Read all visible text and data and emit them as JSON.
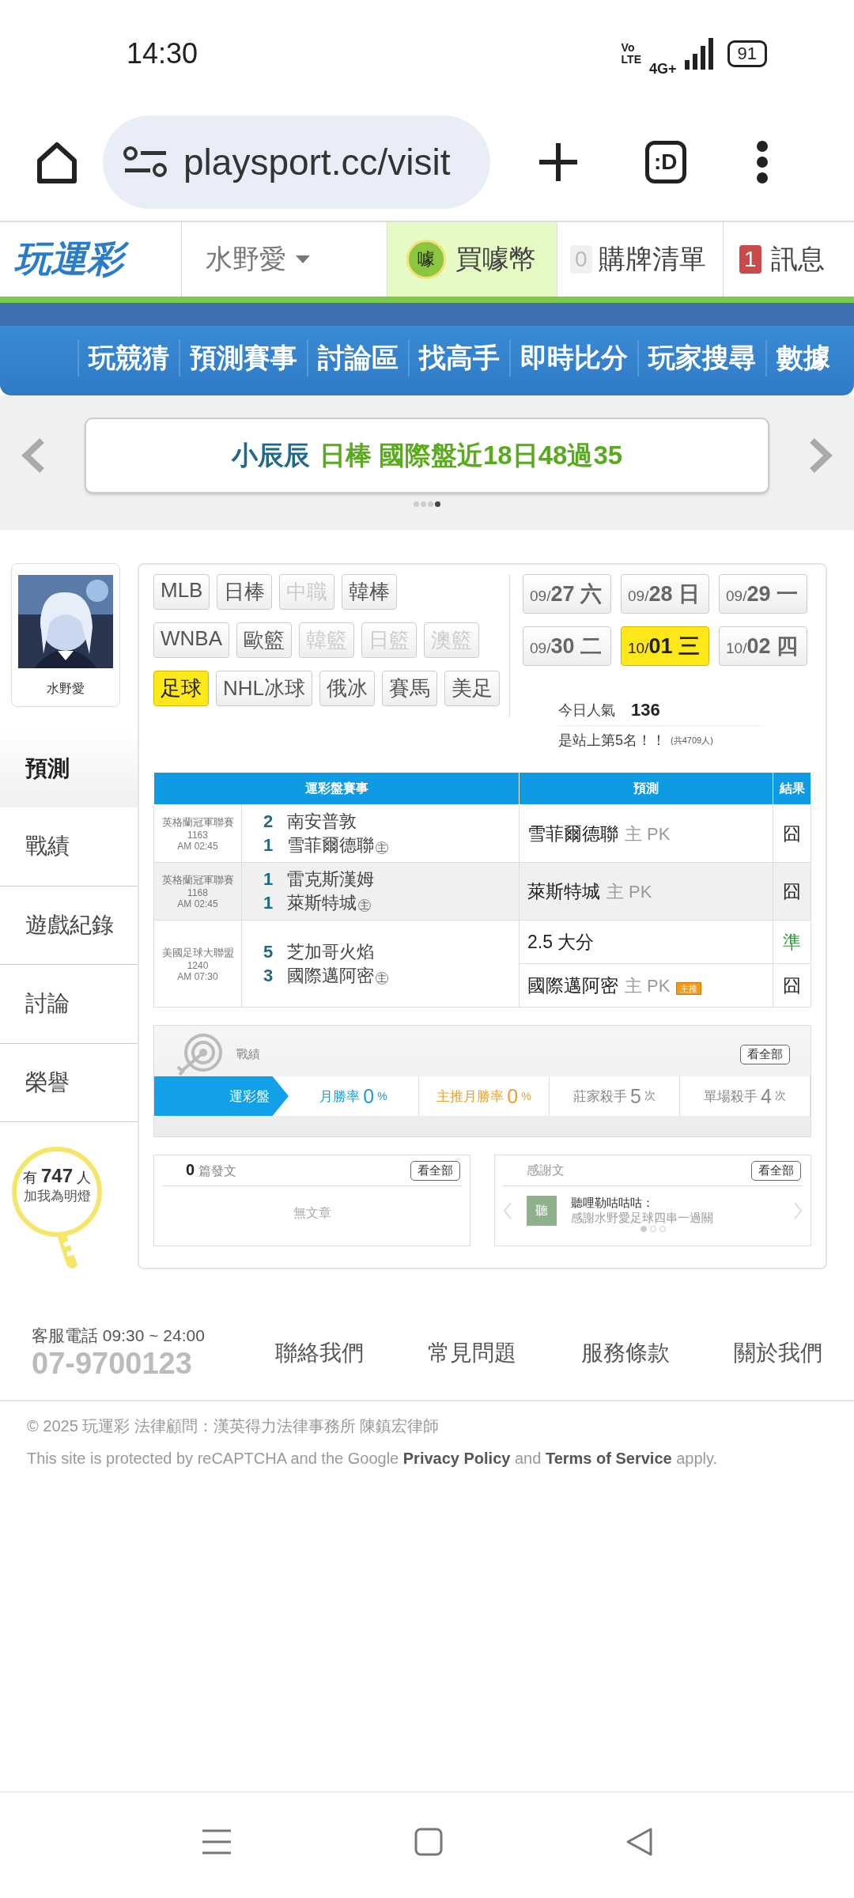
{
  "status_bar": {
    "time": "14:30",
    "volte": "Vo\nLTE",
    "network": "4G+",
    "battery": "91"
  },
  "browser": {
    "url": "playsport.cc/visit",
    "tab_label": ":D"
  },
  "site_header": {
    "logo": "玩運彩",
    "user": "水野愛",
    "coin_glyph": "噱",
    "buy_coins": "買噱幣",
    "cart_count": "0",
    "cart": "購牌清單",
    "message_count": "1",
    "messages": "訊息"
  },
  "nav": [
    "玩競猜",
    "預測賽事",
    "討論區",
    "找高手",
    "即時比分",
    "玩家搜尋",
    "數據"
  ],
  "banner": {
    "name": "小辰辰",
    "text": "日棒 國際盤近18日48過35",
    "dots": [
      {
        "selected": false
      },
      {
        "selected": false
      },
      {
        "selected": false
      },
      {
        "selected": true
      }
    ]
  },
  "profile": {
    "name": "水野愛",
    "menu": [
      {
        "label": "預測",
        "selected": true
      },
      {
        "label": "戰績",
        "selected": false
      },
      {
        "label": "遊戲紀錄",
        "selected": false
      },
      {
        "label": "討論",
        "selected": false
      },
      {
        "label": "榮譽",
        "selected": false
      }
    ],
    "fans": {
      "prefix": "有",
      "count": "747",
      "suffix": "人",
      "caption": "加我為明燈"
    }
  },
  "sports": [
    [
      {
        "label": "MLB",
        "disabled": false,
        "selected": false
      },
      {
        "label": "日棒",
        "disabled": false,
        "selected": false
      },
      {
        "label": "中職",
        "disabled": true,
        "selected": false
      },
      {
        "label": "韓棒",
        "disabled": false,
        "selected": false
      }
    ],
    [
      {
        "label": "WNBA",
        "disabled": false,
        "selected": false
      },
      {
        "label": "歐籃",
        "disabled": false,
        "selected": false
      },
      {
        "label": "韓籃",
        "disabled": true,
        "selected": false
      },
      {
        "label": "日籃",
        "disabled": true,
        "selected": false
      },
      {
        "label": "澳籃",
        "disabled": true,
        "selected": false
      }
    ],
    [
      {
        "label": "足球",
        "disabled": false,
        "selected": true
      },
      {
        "label": "NHL冰球",
        "disabled": false,
        "selected": false
      },
      {
        "label": "俄冰",
        "disabled": false,
        "selected": false
      },
      {
        "label": "賽馬",
        "disabled": false,
        "selected": false
      },
      {
        "label": "美足",
        "disabled": false,
        "selected": false
      }
    ]
  ],
  "dates": [
    {
      "month": "09/",
      "day": "27",
      "weekday": "六",
      "selected": false
    },
    {
      "month": "09/",
      "day": "28",
      "weekday": "日",
      "selected": false
    },
    {
      "month": "09/",
      "day": "29",
      "weekday": "一",
      "selected": false
    },
    {
      "month": "09/",
      "day": "30",
      "weekday": "二",
      "selected": false
    },
    {
      "month": "10/",
      "day": "01",
      "weekday": "三",
      "selected": true
    },
    {
      "month": "10/",
      "day": "02",
      "weekday": "四",
      "selected": false
    }
  ],
  "popularity": {
    "label": "今日人氣",
    "value": "136",
    "rank": "是站上第5名！！",
    "total": "(共4709人)"
  },
  "table": {
    "columns": [
      "運彩盤賽事",
      "預測",
      "結果"
    ],
    "rows": [
      {
        "league": "英格蘭冠軍聯賽",
        "number": "1163",
        "time": "AM 02:45",
        "teams": [
          {
            "score": "2",
            "name": "南安普敦"
          },
          {
            "score": "1",
            "name": "雪菲爾德聯",
            "home": "主"
          }
        ],
        "predictions": [
          {
            "pick": "雪菲爾德聯",
            "note": "主 PK",
            "result": "囧",
            "correct": false
          }
        ]
      },
      {
        "league": "英格蘭冠軍聯賽",
        "number": "1168",
        "time": "AM 02:45",
        "teams": [
          {
            "score": "1",
            "name": "雷克斯漢姆"
          },
          {
            "score": "1",
            "name": "萊斯特城",
            "home": "主"
          }
        ],
        "predictions": [
          {
            "pick": "萊斯特城",
            "note": "主 PK",
            "result": "囧",
            "correct": false
          }
        ]
      },
      {
        "league": "美國足球大聯盟",
        "number": "1240",
        "time": "AM 07:30",
        "teams": [
          {
            "score": "5",
            "name": "芝加哥火焰"
          },
          {
            "score": "3",
            "name": "國際邁阿密",
            "home": "主"
          }
        ],
        "predictions": [
          {
            "pick": "2.5 大分",
            "result": "準",
            "correct": true
          },
          {
            "pick": "國際邁阿密",
            "note": "主 PK",
            "badge": "主推",
            "result": "囧",
            "correct": false
          }
        ]
      }
    ]
  },
  "record": {
    "title": "戰績",
    "view_all": "看全部",
    "tab": "運彩盤",
    "stats": [
      {
        "label": "月勝率",
        "value": "0",
        "unit": "%",
        "color": "#1a9ad6"
      },
      {
        "label": "主推月勝率",
        "value": "0",
        "unit": "%",
        "color": "#e8a030"
      },
      {
        "label": "莊家殺手",
        "value": "5",
        "unit": "次",
        "color": "#888888"
      },
      {
        "label": "單場殺手",
        "value": "4",
        "unit": "次",
        "color": "#888888"
      }
    ]
  },
  "posts": {
    "count": "0",
    "label": "篇發文",
    "view_all": "看全部",
    "empty": "無文章"
  },
  "thanks": {
    "title": "感謝文",
    "view_all": "看全部",
    "avatar": "聽",
    "author": "聽哩勒咕咕咕：",
    "text": "感謝水野愛足球四串一過關",
    "dots": [
      {
        "selected": true
      },
      {
        "selected": false
      },
      {
        "selected": false
      }
    ]
  },
  "footer": {
    "hours": "客服電話 09:30 ~ 24:00",
    "phone": "07-9700123",
    "links": [
      "聯絡我們",
      "常見問題",
      "服務條款",
      "關於我們"
    ],
    "copyright": "© 2025 玩運彩 法律顧問：漢英得力法律事務所 陳鎮宏律師",
    "recaptcha": "This site is protected by reCAPTCHA and the Google **Privacy Policy** and **Terms of Service** apply."
  }
}
